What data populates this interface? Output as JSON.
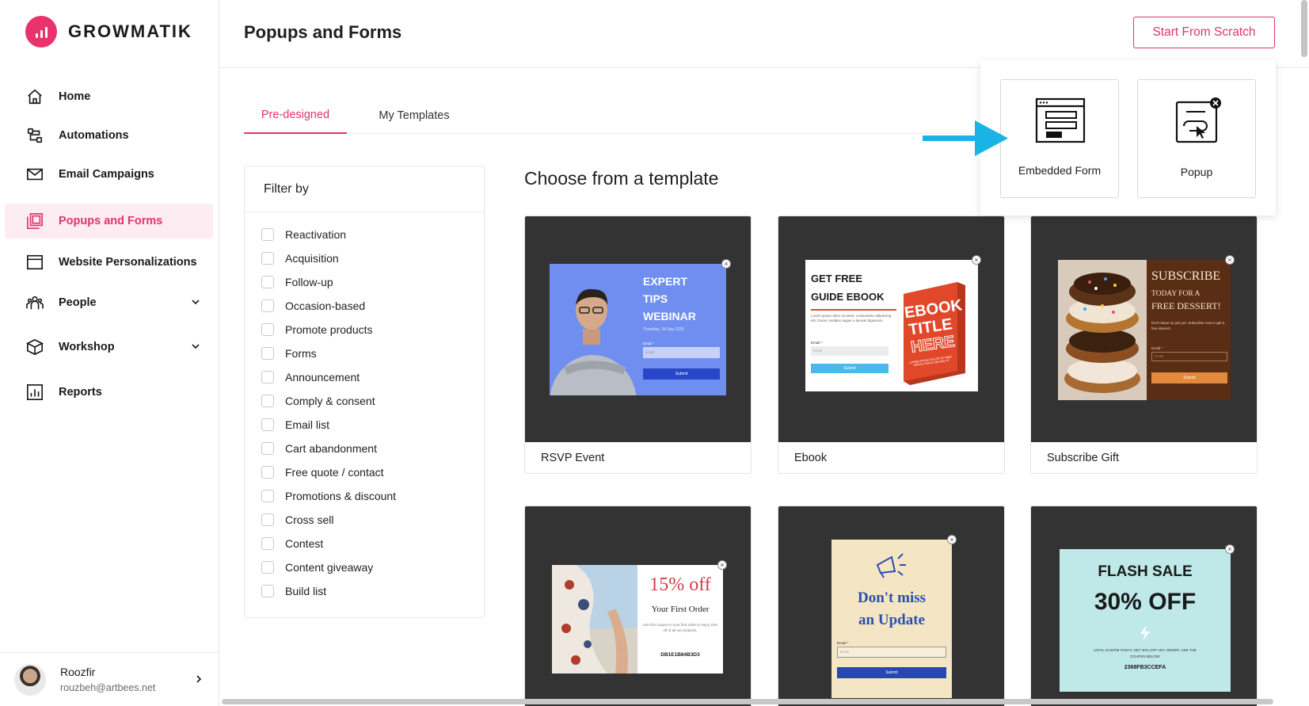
{
  "brand": {
    "name": "GROWMATIK",
    "accent": "#e0356a"
  },
  "sidebar": {
    "items": [
      {
        "label": "Home",
        "icon": "home-icon"
      },
      {
        "label": "Automations",
        "icon": "automations-icon"
      },
      {
        "label": "Email Campaigns",
        "icon": "envelope-icon"
      },
      {
        "label": "Popups and Forms",
        "icon": "popup-icon",
        "active": true
      },
      {
        "label": "Website Personalizations",
        "icon": "browser-window-icon"
      },
      {
        "label": "People",
        "icon": "people-icon",
        "expandable": true
      },
      {
        "label": "Workshop",
        "icon": "cube-icon",
        "expandable": true
      },
      {
        "label": "Reports",
        "icon": "bar-chart-icon"
      }
    ]
  },
  "user": {
    "name": "Roozfir",
    "email": "rouzbeh@artbees.net"
  },
  "header": {
    "title": "Popups and Forms",
    "scratch_button": "Start From Scratch"
  },
  "scratch_menu": {
    "embedded": "Embedded Form",
    "popup": "Popup"
  },
  "tabs": [
    {
      "label": "Pre-designed",
      "active": true
    },
    {
      "label": "My Templates",
      "active": false
    }
  ],
  "filter": {
    "title": "Filter by",
    "options": [
      "Reactivation",
      "Acquisition",
      "Follow-up",
      "Occasion-based",
      "Promote products",
      "Forms",
      "Announcement",
      "Comply & consent",
      "Email list",
      "Cart abandonment",
      "Free quote / contact",
      "Promotions & discount",
      "Cross sell",
      "Contest",
      "Content giveaway",
      "Build list"
    ]
  },
  "section_title": "Choose from a template",
  "templates": {
    "rsvp": {
      "name": "RSVP Event",
      "headline": [
        "EXPERT",
        "TIPS",
        "WEBINAR"
      ],
      "date": "Thursday, 24 Sep 2020",
      "email_label": "Email *",
      "email_placeholder": "Email",
      "button": "Submit"
    },
    "ebook": {
      "name": "Ebook",
      "headline": [
        "GET FREE",
        "GUIDE EBOOK"
      ],
      "body": "Lorem ipsum dolor sit amet, consectetur adipiscing elit. Donec sodales augue a laoreet dignissim.",
      "email_label": "Email *",
      "email_placeholder": "Email",
      "button": "Submit",
      "book_title": [
        "EBOOK",
        "TITLE",
        "HERE"
      ],
      "book_sub": "LOREM IPSUM DOLOR SIT AMET SINGNY SMOD SEA NEL AT"
    },
    "gift": {
      "name": "Subscribe Gift",
      "headline": "SUBSCRIBE",
      "sub": [
        "TODAY FOR A",
        "FREE DESSERT!"
      ],
      "body": "Don't leave us just yet. Subscribe now to get a free dessert.",
      "email_label": "Email *",
      "email_placeholder": "Email",
      "button": "Submit"
    },
    "coupon": {
      "headline": "15% off",
      "sub": "Your First Order",
      "body": "Use this coupon in your first order to enjoy 15% off of all our products.",
      "code": "DB1E1B84B3D3"
    },
    "update": {
      "headline": [
        "Don't miss",
        "an Update"
      ],
      "email_label": "Email *",
      "email_placeholder": "Email",
      "button": "Submit"
    },
    "flash": {
      "headline": "FLASH SALE",
      "percent": "30% OFF",
      "body": "UNTIL 12:00PM TODAY, GET 30% OFF ANY ORDER. USE THE COUPON BELOW:",
      "code": "2368FB3CCEFA"
    }
  }
}
